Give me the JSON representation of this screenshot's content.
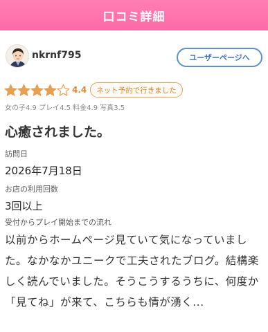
{
  "header": {
    "title": "口コミ詳細"
  },
  "user": {
    "name": "nkrnf795",
    "userpage_button": "ユーザーページへ"
  },
  "rating": {
    "stars_filled": 4,
    "stars_total": 5,
    "value": "4.4",
    "star_color": "#e8a050",
    "net_badge": "ネット予約で行きました"
  },
  "sub_ratings": "女の子4.9 プレイ4.5 料金4.9 写真3.5",
  "review": {
    "title": "心癒されました。",
    "visit_date_label": "訪問日",
    "visit_date": "2026年7月18日",
    "visit_count_label": "お店の利用回数",
    "visit_count": "3回以上",
    "flow_label": "受付からプレイ開始までの流れ",
    "body": "以前からホームページ見ていて気になっていました。なかなかユニークで工夫されたブログ。結構楽しく読んでいました。そうこうするうちに、何度か「見てね」が来て、こちらも情が湧く..."
  },
  "colors": {
    "header_pink": "#ff6aa6",
    "button_blue": "#5b8fd9",
    "badge_orange": "#e8a050"
  }
}
